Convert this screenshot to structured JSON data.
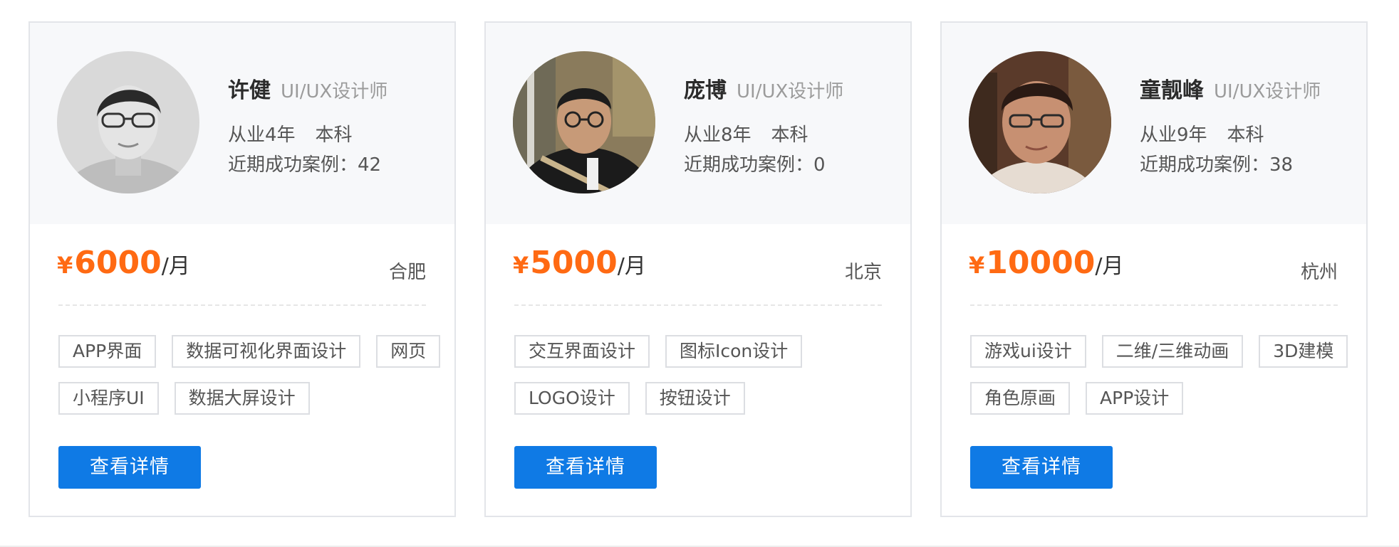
{
  "cards": [
    {
      "name": "许健",
      "role": "UI/UX设计师",
      "experience": "从业4年",
      "education": "本科",
      "cases": "近期成功案例：42",
      "currency": "¥",
      "price": "6000",
      "unit": "/月",
      "city": "合肥",
      "tags": [
        "APP界面",
        "数据可视化界面设计",
        "网页",
        "小程序UI",
        "数据大屏设计"
      ],
      "button": "查看详情"
    },
    {
      "name": "庞博",
      "role": "UI/UX设计师",
      "experience": "从业8年",
      "education": "本科",
      "cases": "近期成功案例：0",
      "currency": "¥",
      "price": "5000",
      "unit": "/月",
      "city": "北京",
      "tags": [
        "交互界面设计",
        "图标Icon设计",
        "LOGO设计",
        "按钮设计"
      ],
      "button": "查看详情"
    },
    {
      "name": "童靓峰",
      "role": "UI/UX设计师",
      "experience": "从业9年",
      "education": "本科",
      "cases": "近期成功案例：38",
      "currency": "¥",
      "price": "10000",
      "unit": "/月",
      "city": "杭州",
      "tags": [
        "游戏ui设计",
        "二维/三维动画",
        "3D建模",
        "角色原画",
        "APP设计"
      ],
      "button": "查看详情"
    }
  ],
  "colors": {
    "accent": "#0f7ae5",
    "price": "#ff6a13",
    "card_top_bg": "#f7f8fa",
    "border": "#e3e5e9"
  }
}
